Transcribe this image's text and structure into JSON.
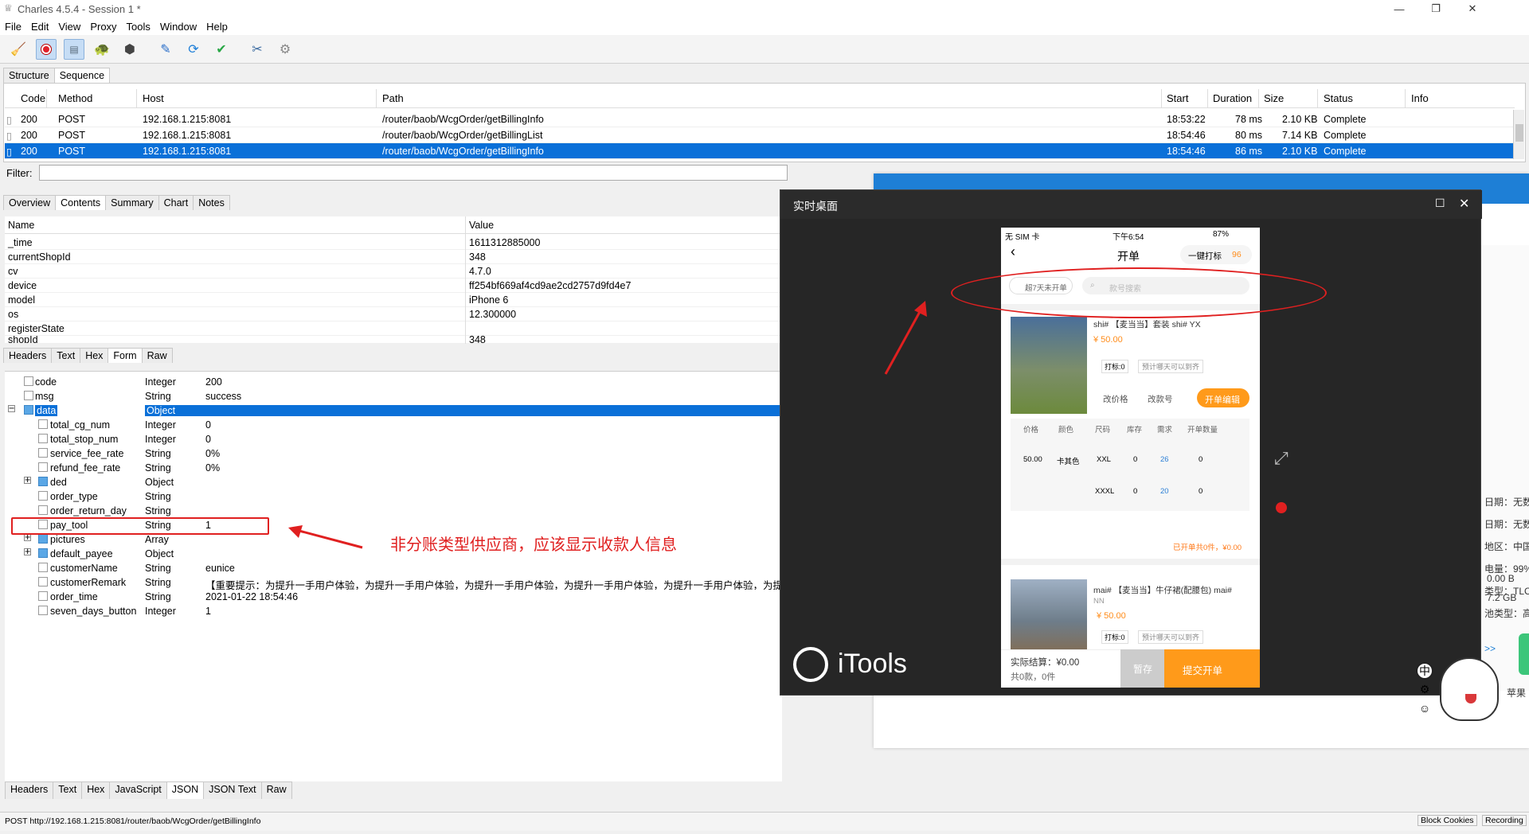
{
  "window": {
    "title": "Charles 4.5.4 - Session 1 *"
  },
  "menu": [
    "File",
    "Edit",
    "View",
    "Proxy",
    "Tools",
    "Window",
    "Help"
  ],
  "top_tabs": [
    "Structure",
    "Sequence"
  ],
  "sequence": {
    "headers": [
      "Code",
      "Method",
      "Host",
      "Path",
      "Start",
      "Duration",
      "Size",
      "Status",
      "Info"
    ],
    "rows": [
      {
        "code": "200",
        "method": "POST",
        "host": "192.168.1.215:8081",
        "path": "/router/baob/WcgOrder/getBillingInfo",
        "start": "18:53:22",
        "duration": "78 ms",
        "size": "2.10 KB",
        "status": "Complete"
      },
      {
        "code": "200",
        "method": "POST",
        "host": "192.168.1.215:8081",
        "path": "/router/baob/WcgOrder/getBillingList",
        "start": "18:54:46",
        "duration": "80 ms",
        "size": "7.14 KB",
        "status": "Complete"
      },
      {
        "code": "200",
        "method": "POST",
        "host": "192.168.1.215:8081",
        "path": "/router/baob/WcgOrder/getBillingInfo",
        "start": "18:54:46",
        "duration": "86 ms",
        "size": "2.10 KB",
        "status": "Complete"
      }
    ]
  },
  "filter": {
    "label": "Filter:",
    "focused": "Focused",
    "settings": "Settings"
  },
  "detail_tabs": [
    "Overview",
    "Contents",
    "Summary",
    "Chart",
    "Notes"
  ],
  "form": {
    "headers": [
      "Name",
      "Value"
    ],
    "rows": [
      {
        "name": "_time",
        "value": "1611312885000"
      },
      {
        "name": "currentShopId",
        "value": "348"
      },
      {
        "name": "cv",
        "value": "4.7.0"
      },
      {
        "name": "device",
        "value": "ff254bf669af4cd9ae2cd2757d9fd4e7"
      },
      {
        "name": "model",
        "value": "iPhone 6"
      },
      {
        "name": "os",
        "value": "12.300000"
      },
      {
        "name": "registerState",
        "value": ""
      },
      {
        "name": "shopId",
        "value": "348"
      }
    ]
  },
  "request_tabs": [
    "Headers",
    "Text",
    "Hex",
    "Form",
    "Raw"
  ],
  "tree": [
    {
      "name": "code",
      "type": "Integer",
      "value": "200"
    },
    {
      "name": "msg",
      "type": "String",
      "value": "success"
    },
    {
      "name": "data",
      "type": "Object",
      "value": ""
    },
    {
      "name": "total_cg_num",
      "type": "Integer",
      "value": "0"
    },
    {
      "name": "total_stop_num",
      "type": "Integer",
      "value": "0"
    },
    {
      "name": "service_fee_rate",
      "type": "String",
      "value": "0%"
    },
    {
      "name": "refund_fee_rate",
      "type": "String",
      "value": "0%"
    },
    {
      "name": "ded",
      "type": "Object",
      "value": ""
    },
    {
      "name": "order_type",
      "type": "String",
      "value": ""
    },
    {
      "name": "order_return_day",
      "type": "String",
      "value": ""
    },
    {
      "name": "pay_tool",
      "type": "String",
      "value": "1"
    },
    {
      "name": "pictures",
      "type": "Array",
      "value": ""
    },
    {
      "name": "default_payee",
      "type": "Object",
      "value": ""
    },
    {
      "name": "customerName",
      "type": "String",
      "value": "eunice"
    },
    {
      "name": "customerRemark",
      "type": "String",
      "value": "【重要提示：为提升一手用户体验，为提升一手用户体验，为提升一手用户体验，为提升一手用户体验，为提升一手用户体验，为提升一"
    },
    {
      "name": "order_time",
      "type": "String",
      "value": "2021-01-22 18:54:46"
    },
    {
      "name": "seven_days_button",
      "type": "Integer",
      "value": "1"
    }
  ],
  "annotation": "非分账类型供应商，应该显示收款人信息",
  "response_tabs": [
    "Headers",
    "Text",
    "Hex",
    "JavaScript",
    "JSON",
    "JSON Text",
    "Raw"
  ],
  "status": {
    "url": "POST http://192.168.1.215:8081/router/baob/WcgOrder/getBillingInfo",
    "block": "Block Cookies",
    "recording": "Recording"
  },
  "bg_side": [
    "日期：无数",
    "日期：无数",
    "地区：中国",
    "电量：99%",
    "类型：TLC",
    "池类型：高温",
    ">>",
    "0.00 B",
    "7.2 GB",
    "苹果"
  ],
  "itools": {
    "title": "实时桌面",
    "brand": "iTools",
    "ime": "中"
  },
  "phone": {
    "carrier": "无 SIM 卡",
    "time": "下午6:54",
    "battery": "87%",
    "page_title": "开单",
    "one_key": "一键打标",
    "one_key_count": "96",
    "filter_chip": "超7天未开单",
    "search_placeholder": "款号搜索",
    "item1": {
      "title": "shi# 【麦当当】套装 shi# YX",
      "price": "¥ 50.00",
      "tag": "打标:0",
      "hint": "预计哪天可以到齐",
      "edit_price": "改价格",
      "edit_no": "改款号",
      "edit_btn": "开单编辑"
    },
    "table_headers": [
      "价格",
      "颜色",
      "尺码",
      "库存",
      "需求",
      "开单数量"
    ],
    "table_rows": [
      [
        "50.00",
        "卡其色",
        "XXL",
        "0",
        "26",
        "0"
      ],
      [
        "",
        "",
        "XXXL",
        "0",
        "20",
        "0"
      ]
    ],
    "opened": "已开单共0件，¥0.00",
    "item2": {
      "title": "mai# 【麦当当】牛仔裙(配腰包) mai#",
      "sub": "NN",
      "price": "¥ 50.00",
      "tag": "打标:0",
      "hint": "预计哪天可以到齐"
    },
    "actual": "实际结算：¥0.00",
    "count": "共0款，0件",
    "save": "暂存",
    "submit": "提交开单"
  }
}
